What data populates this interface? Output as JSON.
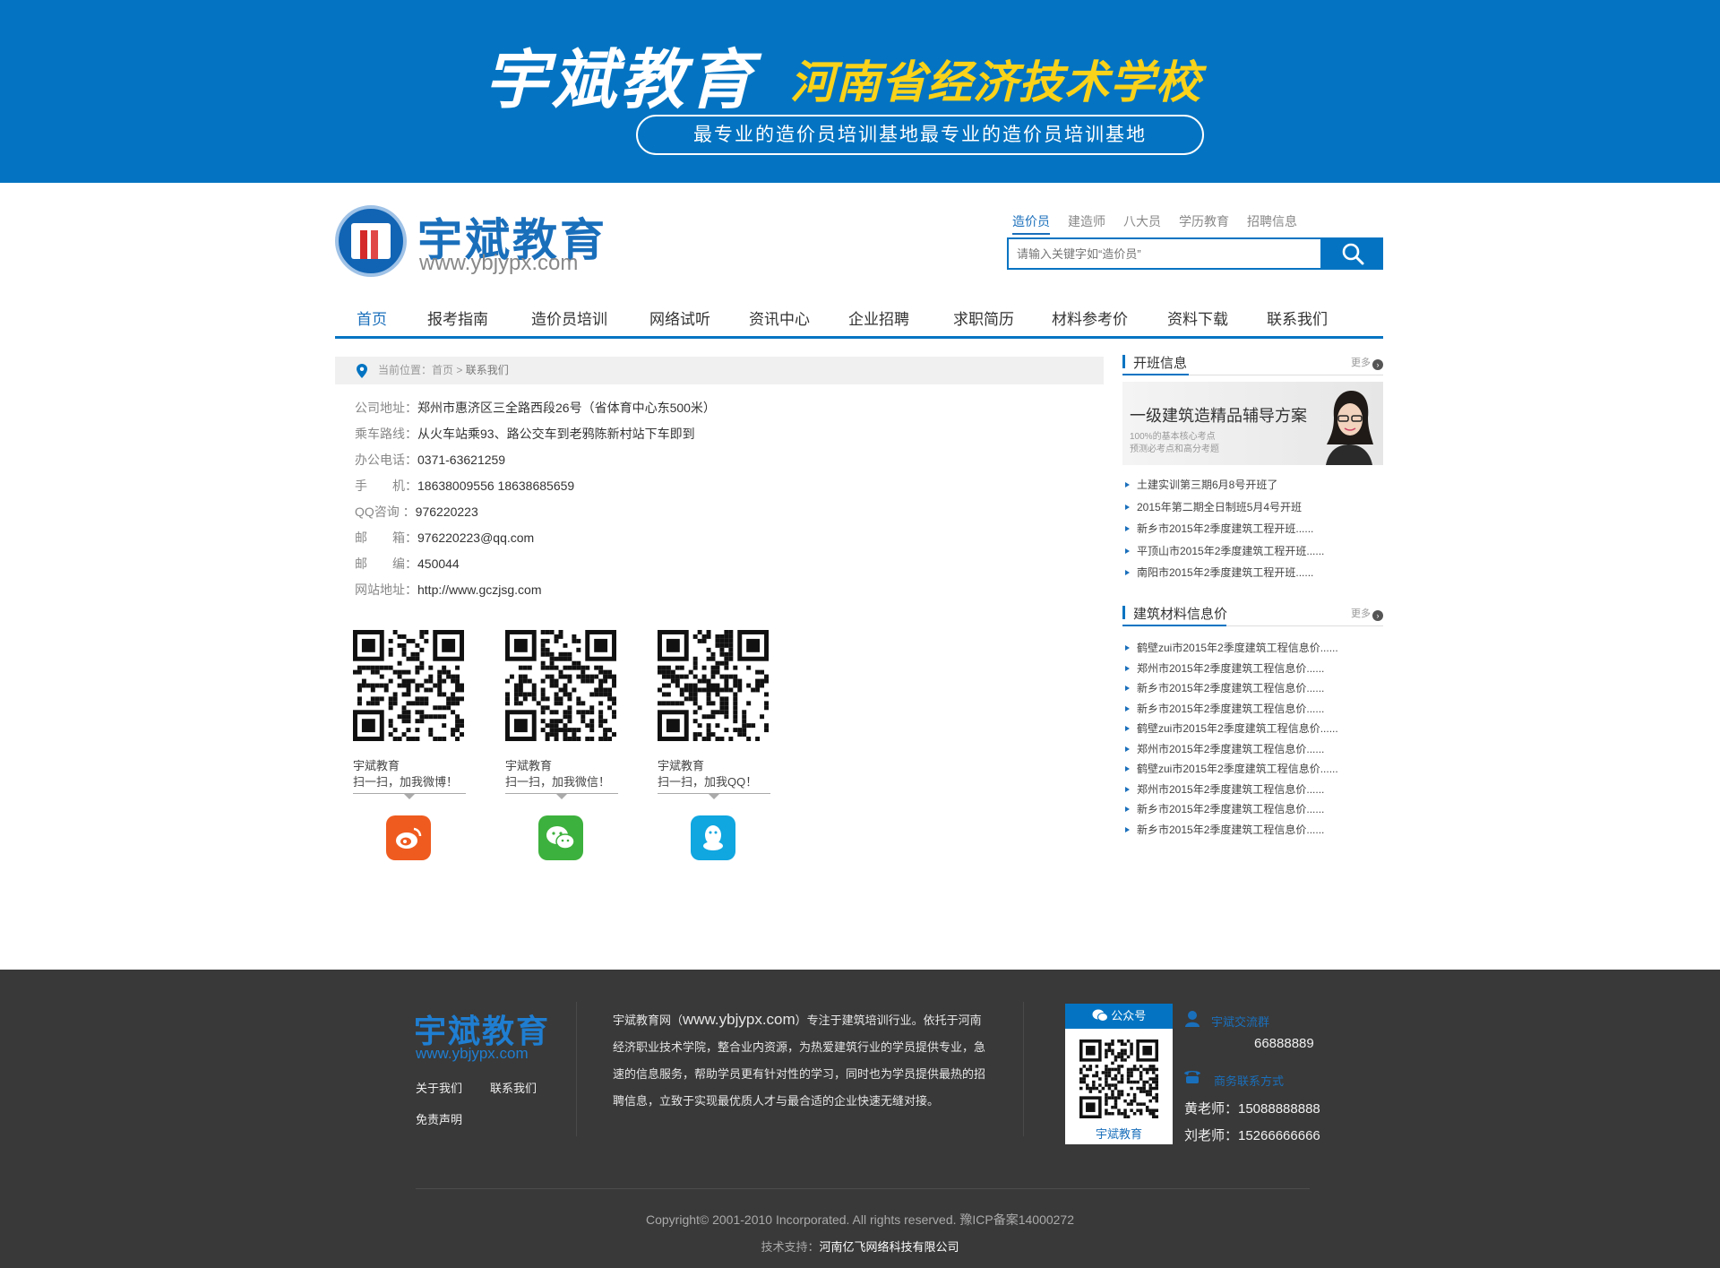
{
  "banner": {
    "title": "宇斌教育",
    "school": "河南省经济技术学校",
    "slogan": "最专业的造价员培训基地最专业的造价员培训基地"
  },
  "header": {
    "logo_name": "宇斌教育",
    "logo_url": "www.ybjypx.com",
    "search_tabs": [
      "造价员",
      "建造师",
      "八大员",
      "学历教育",
      "招聘信息"
    ],
    "search_placeholder": "请输入关键字如“造价员”"
  },
  "nav": [
    "首页",
    "报考指南",
    "造价员培训",
    "网络试听",
    "资讯中心",
    "企业招聘",
    "求职简历",
    "材料参考价",
    "资料下载",
    "联系我们"
  ],
  "breadcrumb": {
    "prefix": "当前位置：首页 > ",
    "current": "联系我们"
  },
  "contact": [
    {
      "label": "公司地址：",
      "value": "郑州市惠济区三全路西段26号（省体育中心东500米）"
    },
    {
      "label": "乘车路线：",
      "value": "从火车站乘93、路公交车到老鸦陈新村站下车即到"
    },
    {
      "label": "办公电话：",
      "value": "0371-63621259"
    },
    {
      "label": "手　　机：",
      "value": "18638009556  18638685659"
    },
    {
      "label": "QQ咨询 ：",
      "value": "976220223"
    },
    {
      "label": "邮　　箱：",
      "value": "976220223@qq.com"
    },
    {
      "label": "邮　　编：",
      "value": "450044"
    },
    {
      "label": "网站地址：",
      "value": "http://www.gczjsg.com"
    }
  ],
  "qr_cards": [
    {
      "name": "宇斌教育",
      "action": "扫一扫，加我微博！",
      "icon": "weibo-icon",
      "color": "#ef5b1f"
    },
    {
      "name": "宇斌教育",
      "action": "扫一扫，加我微信！",
      "icon": "wechat-icon",
      "color": "#3db13d"
    },
    {
      "name": "宇斌教育",
      "action": "扫一扫，加我QQ！",
      "icon": "qq-icon",
      "color": "#10a6e0"
    }
  ],
  "sidebar": {
    "classes": {
      "title": "开班信息",
      "more": "更多",
      "banner_title": "一级建筑造精品辅导方案",
      "banner_sub1": "100%的基本核心考点",
      "banner_sub2": "预测必考点和高分考题",
      "items": [
        "土建实训第三期6月8号开班了",
        "2015年第二期全日制班5月4号开班",
        "新乡市2015年2季度建筑工程开班......",
        "平顶山市2015年2季度建筑工程开班......",
        "南阳市2015年2季度建筑工程开班......"
      ]
    },
    "materials": {
      "title": "建筑材料信息价",
      "more": "更多",
      "items": [
        "鹤壁zui市2015年2季度建筑工程信息价......",
        "郑州市2015年2季度建筑工程信息价......",
        "新乡市2015年2季度建筑工程信息价......",
        "新乡市2015年2季度建筑工程信息价......",
        "鹤壁zui市2015年2季度建筑工程信息价......",
        "郑州市2015年2季度建筑工程信息价......",
        "鹤壁zui市2015年2季度建筑工程信息价......",
        "郑州市2015年2季度建筑工程信息价......",
        "新乡市2015年2季度建筑工程信息价......",
        "新乡市2015年2季度建筑工程信息价......"
      ]
    }
  },
  "footer": {
    "logo": "宇斌教育",
    "url": "www.ybjypx.com",
    "links": [
      "关于我们",
      "联系我们",
      "免责声明"
    ],
    "about_prefix": "宇斌教育网（",
    "about_url": "www.ybjypx.com",
    "about_text": "）专注于建筑培训行业。依托于河南经济职业技术学院，整合业内资源，为热爱建筑行业的学员提供专业，急速的信息服务，帮助学员更有针对性的学习，同时也为学员提供最热的招聘信息，立致于实现最优质人才与最合适的企业快速无缝对接。",
    "wechat_label": "公众号",
    "wechat_name": "宇斌教育",
    "group_title": "宇斌交流群",
    "group_number": "66888889",
    "biz_title": "商务联系方式",
    "contact1": "黄老师：15088888888",
    "contact2": "刘老师：15266666666",
    "copyright": "Copyright© 2001-2010 Incorporated. All rights reserved. 豫ICP备案14000272",
    "tech_prefix": "技术支持：",
    "tech_company": "河南亿飞网络科技有限公司"
  },
  "colors": {
    "brand_blue": "#0474c2",
    "banner_yellow": "#f9d21a",
    "footer_bg": "#393939"
  }
}
